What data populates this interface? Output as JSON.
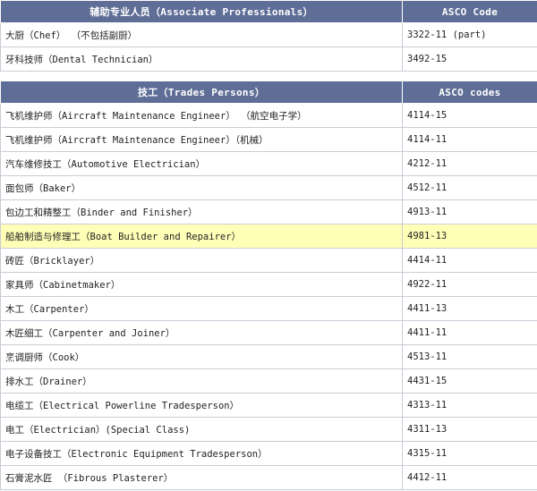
{
  "table1": {
    "header": {
      "title": "辅助专业人员（Associate Professionals）",
      "code": "ASCO Code"
    },
    "rows": [
      {
        "name": "大厨（Chef） （不包括副厨）",
        "code": "3322-11 (part)"
      },
      {
        "name": "牙科技师（Dental Technician）",
        "code": "3492-15"
      }
    ]
  },
  "table2": {
    "header": {
      "title": "技工（Trades Persons）",
      "code": "ASCO codes"
    },
    "rows": [
      {
        "name": "飞机维护师（Aircraft Maintenance Engineer） （航空电子学）",
        "code": "4114-15"
      },
      {
        "name": "飞机维护师（Aircraft Maintenance Engineer）（机械）",
        "code": "4114-11"
      },
      {
        "name": "汽车维修技工（Automotive Electrician）",
        "code": "4212-11"
      },
      {
        "name": "面包师（Baker）",
        "code": "4512-11"
      },
      {
        "name": "包边工和精整工（Binder and Finisher）",
        "code": "4913-11"
      },
      {
        "name": "船舶制造与修理工（Boat Builder and Repairer）",
        "code": "4981-13"
      },
      {
        "name": "砖匠（Bricklayer）",
        "code": "4414-11"
      },
      {
        "name": "家具师（Cabinetmaker）",
        "code": "4922-11"
      },
      {
        "name": "木工（Carpenter）",
        "code": "4411-13"
      },
      {
        "name": "木匠细工（Carpenter and Joiner）",
        "code": "4411-11"
      },
      {
        "name": "烹调厨师（Cook）",
        "code": "4513-11"
      },
      {
        "name": "排水工（Drainer）",
        "code": "4431-15"
      },
      {
        "name": "电缆工（Electrical Powerline Tradesperson）",
        "code": "4313-11"
      },
      {
        "name": "电工（Electrician）(Special Class)",
        "code": "4311-13"
      },
      {
        "name": "电子设备技工（Electronic Equipment Tradesperson）",
        "code": "4315-11"
      },
      {
        "name": "石膏泥水匠 （Fibrous Plasterer）",
        "code": "4412-11"
      }
    ]
  },
  "highlight_color": "#ffffb8",
  "header_color": "#5f6e96"
}
